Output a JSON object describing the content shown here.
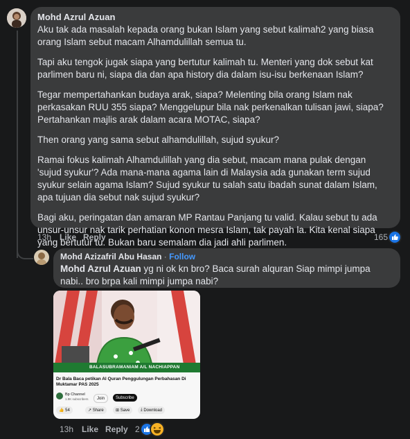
{
  "comment1": {
    "author": "Mohd Azrul Azuan",
    "paragraphs": [
      "Aku tak ada masalah kepada orang bukan Islam yang sebut kalimah2 yang biasa orang Islam sebut macam Alhamdulillah semua tu.",
      "Tapi aku tengok jugak siapa yang bertutur kalimah tu. Menteri yang dok sebut kat parlimen baru ni, siapa dia dan apa history dia dalam isu-isu berkenaan Islam?",
      "Tegar mempertahankan budaya arak, siapa? Melenting bila orang Islam nak perkasakan RUU 355 siapa? Menggelupur bila nak perkenalkan tulisan jawi, siapa? Pertahankan majlis arak dalam acara MOTAC, siapa?",
      "Then orang yang sama sebut alhamdulillah, sujud syukur?",
      "Ramai fokus kalimah Alhamdulillah yang dia sebut, macam mana pulak dengan 'sujud syukur'? Ada mana-mana agama lain di Malaysia ada gunakan term sujud syukur selain agama Islam? Sujud syukur tu salah satu ibadah sunat dalam Islam, apa tujuan dia sebut nak sujud syukur?",
      "Bagi aku, peringatan dan amaran MP Rantau Panjang tu valid. Kalau sebut tu ada unsur-unsur nak tarik perhatian konon mesra Islam, tak payah la. Kita kenal siapa yang bertutur tu. Bukan baru semalam dia jadi ahli parlimen."
    ],
    "time": "13h",
    "like_label": "Like",
    "reply_label": "Reply",
    "reaction_count": "165"
  },
  "reply": {
    "author": "Mohd Azizafril Abu Hasan",
    "separator": " · ",
    "follow_label": "Follow",
    "mention": "Mohd Azrul Azuan",
    "text": " yg ni ok kn bro? Baca surah alquran Siap mimpi jumpa nabi.. bro brpa kali mimpi jumpa nabi?",
    "time": "13h",
    "like_label": "Like",
    "reply_label": "Reply",
    "reaction_count": "2"
  },
  "video_card": {
    "lower_third_name": "BALASUBRAMANIAM A/L NACHIAPPAN",
    "title": "Dr Bala Baca petikan Al Quran Penggulungan Perbahasan Di Muktamar PAS 2025",
    "channel": "Bp Channel",
    "subscribers": "1.9K subscribers",
    "join_label": "Join",
    "subscribe_label": "Subscribe",
    "likes": "54",
    "share_label": "Share",
    "save_label": "Save",
    "download_label": "Download"
  },
  "colors": {
    "background": "#18191a",
    "bubble": "#3a3b3c",
    "follow": "#4599ff",
    "like_blue": "#1b74e4"
  }
}
